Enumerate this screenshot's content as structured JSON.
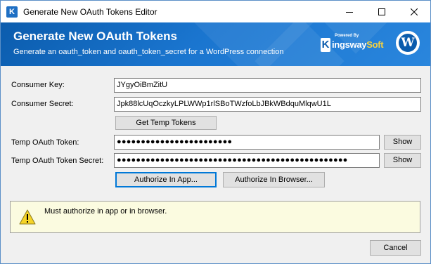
{
  "window": {
    "title": "Generate New OAuth Tokens Editor",
    "app_icon_letter": "K"
  },
  "banner": {
    "title": "Generate New OAuth Tokens",
    "subtitle": "Generate an oauth_token and oauth_token_secret for a WordPress connection",
    "brand": {
      "powered_by": "Powered By",
      "k_letter": "K",
      "name_a": "ingsway",
      "name_b": "Soft"
    },
    "wp_letter": "W"
  },
  "form": {
    "consumer_key_label": "Consumer Key:",
    "consumer_key_value": "JYgyOiBmZitU",
    "consumer_secret_label": "Consumer Secret:",
    "consumer_secret_value": "Jpk88lcUqOczkyLPLWWp1rlSBoTWzfoLbJBkWBdquMlqwU1L",
    "get_temp_tokens_label": "Get Temp Tokens",
    "temp_token_label": "Temp OAuth Token:",
    "temp_token_value": "●●●●●●●●●●●●●●●●●●●●●●●●",
    "temp_token_show": "Show",
    "temp_secret_label": "Temp OAuth Token Secret:",
    "temp_secret_value": "●●●●●●●●●●●●●●●●●●●●●●●●●●●●●●●●●●●●●●●●●●●●●●●●",
    "temp_secret_show": "Show",
    "authorize_app_label": "Authorize In App...",
    "authorize_browser_label": "Authorize In Browser..."
  },
  "message": {
    "text": "Must authorize in app or in browser."
  },
  "footer": {
    "cancel_label": "Cancel"
  },
  "colors": {
    "banner_start": "#0b5cad",
    "banner_end": "#2a86dd",
    "message_bg": "#fbfbe0",
    "focus_border": "#0078d7"
  },
  "icons": [
    "kingswaysoft-app-icon",
    "minimize-icon",
    "maximize-icon",
    "close-icon",
    "kingswaysoft-logo",
    "wordpress-logo",
    "warning-icon"
  ]
}
